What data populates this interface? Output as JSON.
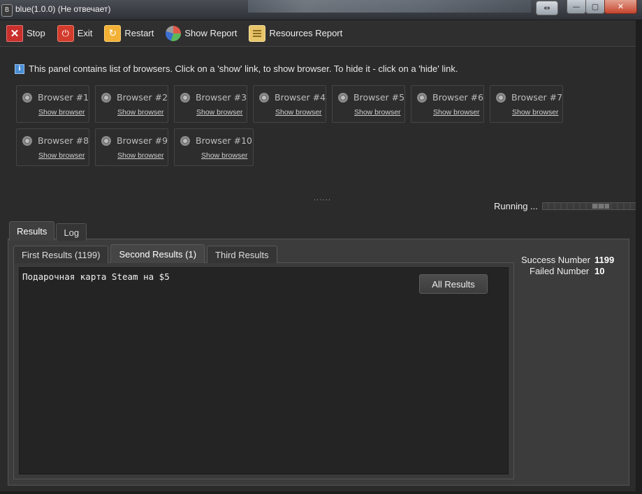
{
  "window": {
    "app_icon": "B",
    "title": "blue(1.0.0) (Не отвечает)",
    "controls": [
      "swap-icon",
      "minimize-icon",
      "maximize-icon",
      "close-icon"
    ]
  },
  "toolbar": {
    "items": [
      {
        "label": "Stop",
        "icon": "stop-icon"
      },
      {
        "label": "Exit",
        "icon": "power-icon"
      },
      {
        "label": "Restart",
        "icon": "restart-icon"
      },
      {
        "label": "Show Report",
        "icon": "pie-chart-icon"
      },
      {
        "label": "Resources Report",
        "icon": "list-icon"
      }
    ]
  },
  "info": {
    "icon": "info-icon",
    "text": "This panel contains list of browsers. Click on a 'show' link, to show browser. To hide it - click on a 'hide' link."
  },
  "browsers": [
    {
      "name": "Browser #1",
      "link": "Show browser"
    },
    {
      "name": "Browser #2",
      "link": "Show browser"
    },
    {
      "name": "Browser #3",
      "link": "Show browser"
    },
    {
      "name": "Browser #4",
      "link": "Show browser"
    },
    {
      "name": "Browser #5",
      "link": "Show browser"
    },
    {
      "name": "Browser #6",
      "link": "Show browser"
    },
    {
      "name": "Browser #7",
      "link": "Show browser"
    },
    {
      "name": "Browser #8",
      "link": "Show browser"
    },
    {
      "name": "Browser #9",
      "link": "Show browser"
    },
    {
      "name": "Browser #10",
      "link": "Show browser"
    }
  ],
  "status": {
    "text": "Running ...",
    "progress_percent": 65
  },
  "outer_tabs": [
    {
      "label": "Results",
      "active": true
    },
    {
      "label": "Log",
      "active": false
    }
  ],
  "inner_tabs": [
    {
      "label": "First Results (1199)",
      "active": false
    },
    {
      "label": "Second Results (1)",
      "active": true
    },
    {
      "label": "Third Results",
      "active": false
    }
  ],
  "results": {
    "lines": [
      "Подарочная карта Steam на $5"
    ],
    "all_results_label": "All Results"
  },
  "stats": {
    "success_label": "Success Number",
    "success_value": "1199",
    "failed_label": "Failed Number",
    "failed_value": "10"
  }
}
